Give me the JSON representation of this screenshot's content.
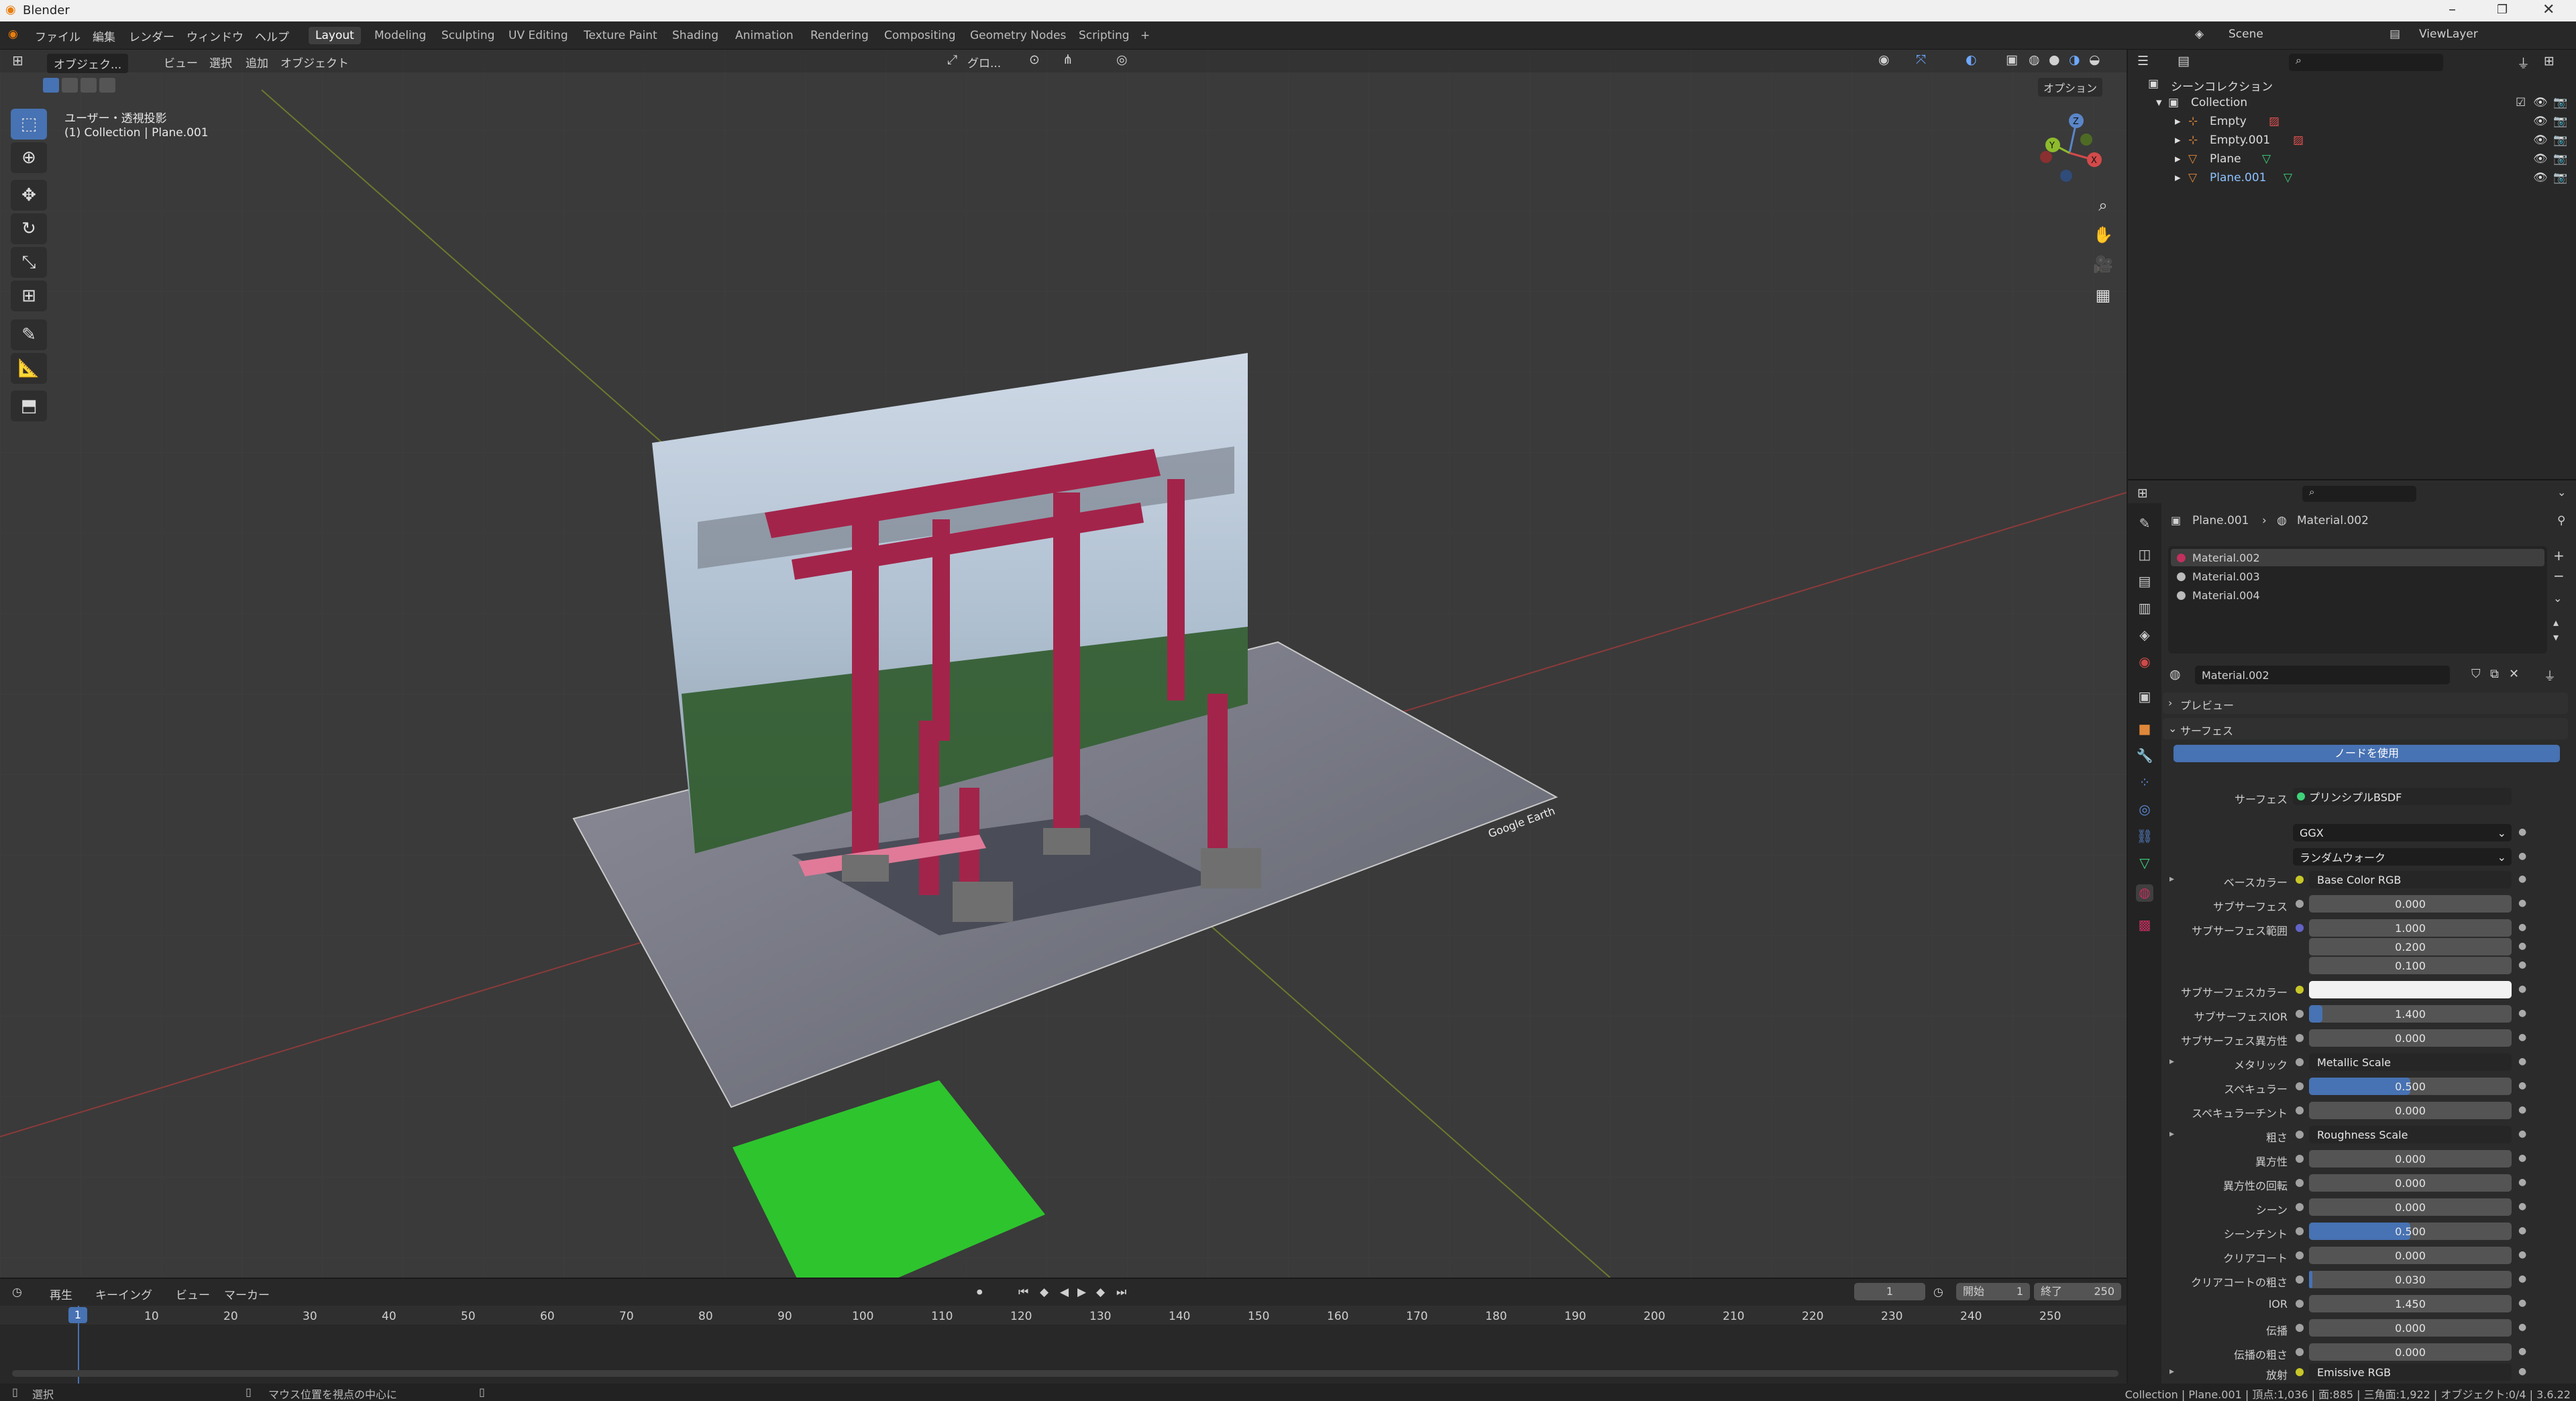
{
  "app": {
    "title": "Blender"
  },
  "menu": {
    "file": "ファイル",
    "edit": "編集",
    "render": "レンダー",
    "window": "ウィンドウ",
    "help": "ヘルプ"
  },
  "workspaces": [
    "Layout",
    "Modeling",
    "Sculpting",
    "UV Editing",
    "Texture Paint",
    "Shading",
    "Animation",
    "Rendering",
    "Compositing",
    "Geometry Nodes",
    "Scripting"
  ],
  "scene": {
    "name": "Scene",
    "view_layer": "ViewLayer"
  },
  "viewport": {
    "mode": "オブジェク...",
    "menus": [
      "ビュー",
      "選択",
      "追加",
      "オブジェクト"
    ],
    "transform_orientation": "グロ...",
    "options": "オプション",
    "view_name": "ユーザー・透視投影",
    "view_info": "(1) Collection | Plane.001",
    "watermark": "Google Earth"
  },
  "outliner": {
    "root": "シーンコレクション",
    "collection": "Collection",
    "items": [
      "Empty",
      "Empty.001",
      "Plane",
      "Plane.001"
    ]
  },
  "properties": {
    "breadcrumb_object": "Plane.001",
    "breadcrumb_material": "Material.002",
    "slots": [
      "Material.002",
      "Material.003",
      "Material.004"
    ],
    "material_name": "Material.002",
    "panel_preview": "プレビュー",
    "panel_surface": "サーフェス",
    "use_nodes": "ノードを使用",
    "surface_label": "サーフェス",
    "surface_value": "プリンシプルBSDF",
    "distribution": "GGX",
    "subsurface_method": "ランダムウォーク",
    "rows": [
      {
        "label": "ベースカラー",
        "value": "Base Color RGB"
      },
      {
        "label": "サブサーフェス",
        "value": "0.000"
      },
      {
        "label": "サブサーフェス範囲",
        "value": "1.000"
      },
      {
        "label": "",
        "value": "0.200"
      },
      {
        "label": "",
        "value": "0.100"
      },
      {
        "label": "サブサーフェスカラー",
        "value": ""
      },
      {
        "label": "サブサーフェスIOR",
        "value": "1.400"
      },
      {
        "label": "サブサーフェス異方性",
        "value": "0.000"
      },
      {
        "label": "メタリック",
        "value": "Metallic Scale"
      },
      {
        "label": "スペキュラー",
        "value": "0.500"
      },
      {
        "label": "スペキュラーチント",
        "value": "0.000"
      },
      {
        "label": "粗さ",
        "value": "Roughness Scale"
      },
      {
        "label": "異方性",
        "value": "0.000"
      },
      {
        "label": "異方性の回転",
        "value": "0.000"
      },
      {
        "label": "シーン",
        "value": "0.000"
      },
      {
        "label": "シーンチント",
        "value": "0.500"
      },
      {
        "label": "クリアコート",
        "value": "0.000"
      },
      {
        "label": "クリアコートの粗さ",
        "value": "0.030"
      },
      {
        "label": "IOR",
        "value": "1.450"
      },
      {
        "label": "伝播",
        "value": "0.000"
      },
      {
        "label": "伝播の粗さ",
        "value": "0.000"
      },
      {
        "label": "放射",
        "value": "Emissive RGB"
      }
    ]
  },
  "timeline": {
    "playback": "再生",
    "keying": "キーイング",
    "view": "ビュー",
    "marker": "マーカー",
    "current_frame": "1",
    "start_label": "開始",
    "start": "1",
    "end_label": "終了",
    "end": "250",
    "ticks": [
      "1",
      "10",
      "20",
      "30",
      "40",
      "50",
      "60",
      "70",
      "80",
      "90",
      "100",
      "110",
      "120",
      "130",
      "140",
      "150",
      "160",
      "170",
      "180",
      "190",
      "200",
      "210",
      "220",
      "230",
      "240",
      "250"
    ]
  },
  "status": {
    "left": "選択",
    "middle": "マウス位置を視点の中心に",
    "right": "Collection | Plane.001 | 頂点:1,036 | 面:885 | 三角面:1,922 | オブジェクト:0/4 | 3.6.22"
  }
}
